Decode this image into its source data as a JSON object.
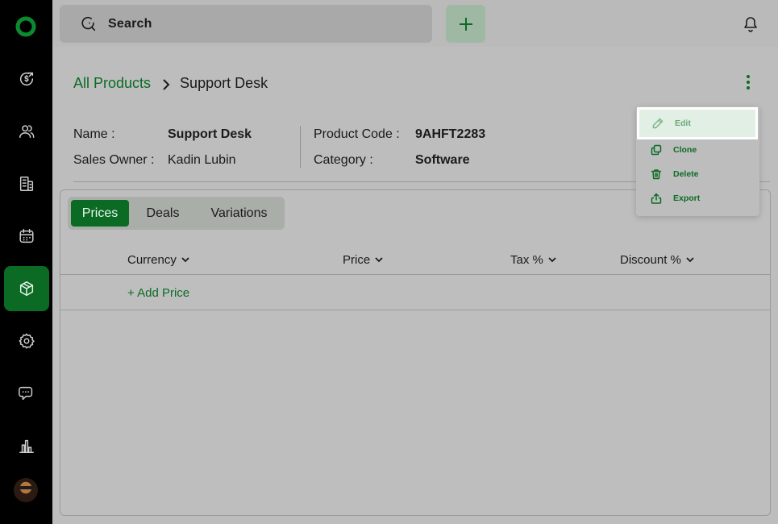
{
  "colors": {
    "accent": "#0b6b25",
    "sidebar_bg": "#000000",
    "overlay": "#bdbdbd"
  },
  "sidebar": {
    "items": [
      {
        "icon": "logo-icon"
      },
      {
        "icon": "dollar-refresh-icon"
      },
      {
        "icon": "users-icon"
      },
      {
        "icon": "building-icon"
      },
      {
        "icon": "calendar-icon"
      },
      {
        "icon": "cube-icon",
        "active": true
      },
      {
        "icon": "gear-icon"
      },
      {
        "icon": "chat-icon"
      },
      {
        "icon": "bar-chart-icon"
      },
      {
        "icon": "avatar"
      }
    ]
  },
  "topbar": {
    "search_label": "Search",
    "add_icon": "plus-icon",
    "notification_icon": "bell-icon"
  },
  "breadcrumb": {
    "parent": "All Products",
    "current": "Support Desk"
  },
  "details": {
    "name_label": "Name :",
    "name_value": "Support Desk",
    "sales_owner_label": "Sales Owner :",
    "sales_owner_value": "Kadin Lubin",
    "product_code_label": "Product Code :",
    "product_code_value": "9AHFT2283",
    "category_label": "Category :",
    "category_value": "Software"
  },
  "tabs": [
    {
      "label": "Prices",
      "active": true
    },
    {
      "label": "Deals",
      "active": false
    },
    {
      "label": "Variations",
      "active": false
    }
  ],
  "table": {
    "columns": [
      "Currency",
      "Price",
      "Tax %",
      "Discount %"
    ],
    "add_label": "+ Add Price"
  },
  "menu": {
    "items": [
      {
        "label": "Edit",
        "icon": "pencil-icon",
        "highlighted": true
      },
      {
        "label": "Clone",
        "icon": "copy-icon"
      },
      {
        "label": "Delete",
        "icon": "trash-icon"
      },
      {
        "label": "Export",
        "icon": "export-icon"
      }
    ]
  }
}
